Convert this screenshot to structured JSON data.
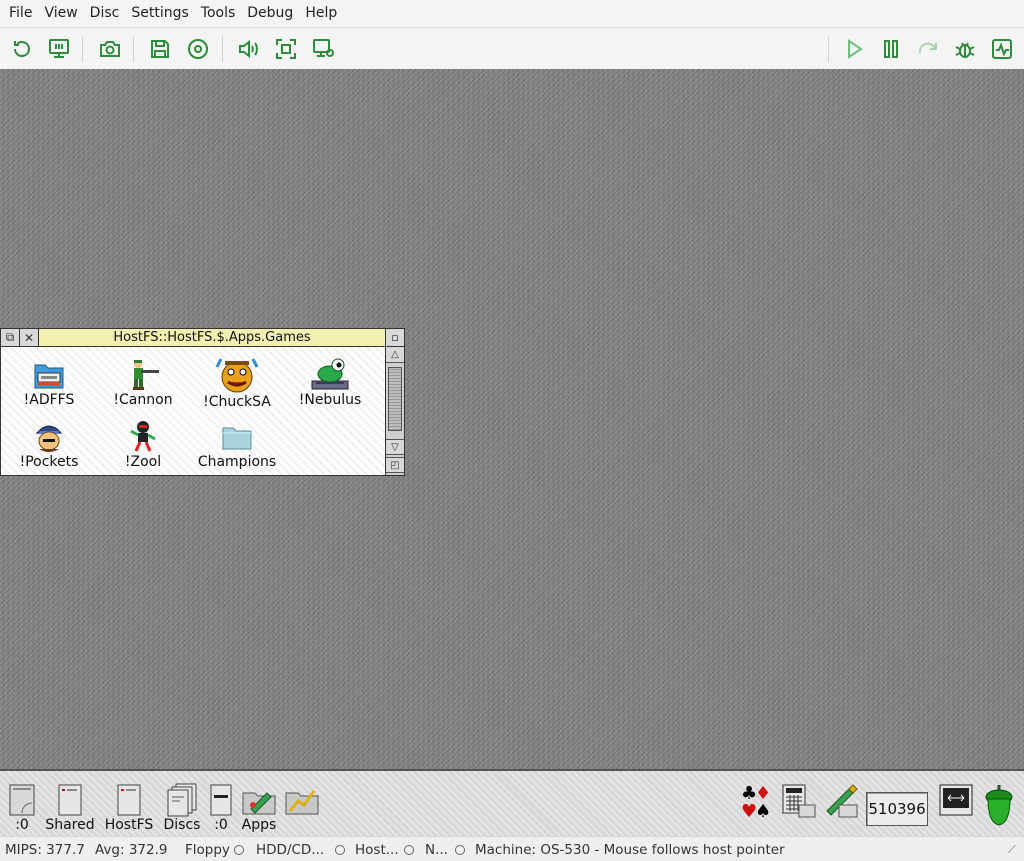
{
  "menu": [
    "File",
    "View",
    "Disc",
    "Settings",
    "Tools",
    "Debug",
    "Help"
  ],
  "toolbar": {
    "left": [
      "reset-icon",
      "monitor-icon",
      "camera-icon",
      "save-icon",
      "disc-icon",
      "sound-icon",
      "fullscreen-icon",
      "display-settings-icon"
    ],
    "right": [
      "play-icon",
      "pause-icon",
      "step-icon",
      "debug-bug-icon",
      "activity-icon"
    ],
    "accent": "#2e8b3c"
  },
  "filer": {
    "title": "HostFS::HostFS.$.Apps.Games",
    "items": [
      {
        "label": "!ADFFS",
        "icon": "adffs-icon"
      },
      {
        "label": "!Cannon",
        "icon": "cannon-icon"
      },
      {
        "label": "!ChuckSA",
        "icon": "chucksa-icon"
      },
      {
        "label": "!Nebulus",
        "icon": "nebulus-icon"
      },
      {
        "label": "!Pockets",
        "icon": "pockets-icon"
      },
      {
        "label": "!Zool",
        "icon": "zool-icon"
      },
      {
        "label": "Champions",
        "icon": "folder-icon"
      }
    ]
  },
  "iconbar": {
    "left": [
      {
        "label": ":0",
        "icon": "floppy-drive-icon"
      },
      {
        "label": "Shared",
        "icon": "shared-drive-icon"
      },
      {
        "label": "HostFS",
        "icon": "hostfs-drive-icon"
      },
      {
        "label": "Discs",
        "icon": "discs-icon"
      },
      {
        "label": ":0",
        "icon": "ram-disc-icon"
      },
      {
        "label": "Apps",
        "icon": "apps-icon"
      },
      {
        "label": "",
        "icon": "chart-app-icon"
      }
    ],
    "memory": "510396",
    "right": [
      "patience-cards-icon",
      "calculator-icon",
      "paint-icon",
      "display-mode-icon",
      "acorn-icon"
    ]
  },
  "status": {
    "mips": "MIPS: 377.7",
    "avg": "Avg: 372.9",
    "floppy": "Floppy",
    "hdd": "HDD/CD...",
    "host": "Host...",
    "net": "N...",
    "machine": "Machine: OS-530 - Mouse follows host pointer"
  }
}
